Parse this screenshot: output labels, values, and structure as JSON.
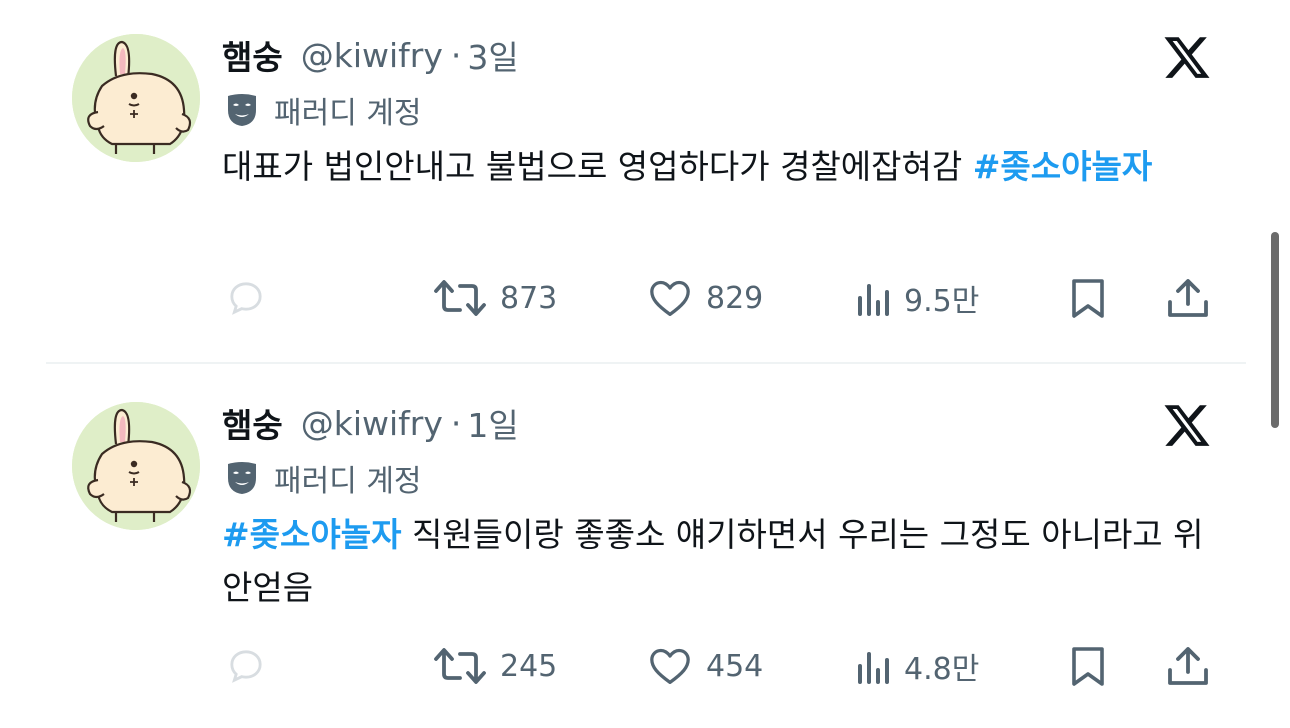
{
  "tweets": [
    {
      "display_name": "햄숭",
      "handle": "@kiwifry",
      "separator": "·",
      "time": "3일",
      "parody_label": "패러디 계정",
      "text_plain": "대표가 법인안내고 불법으로 영업하다가 경찰에잡혀감 ",
      "hashtag": "#좆소야놀자",
      "retweets": "873",
      "likes": "829",
      "views": "9.5만"
    },
    {
      "display_name": "햄숭",
      "handle": "@kiwifry",
      "separator": "·",
      "time": "1일",
      "parody_label": "패러디 계정",
      "hashtag": "#좆소야놀자",
      "text_plain": " 직원들이랑 좋좋소 얘기하면서 우리는 그정도 아니라고 위안얻음",
      "retweets": "245",
      "likes": "454",
      "views": "4.8만"
    }
  ],
  "colors": {
    "text": "#0f1419",
    "secondary": "#536471",
    "hashtag": "#1d9bf0",
    "divider": "#eff3f4",
    "avatar_bg": "#dfeec8"
  },
  "icons": [
    "avatar",
    "x-logo-icon",
    "parody-mask-icon",
    "reply-icon",
    "retweet-icon",
    "like-icon",
    "views-icon",
    "bookmark-icon",
    "share-icon"
  ]
}
